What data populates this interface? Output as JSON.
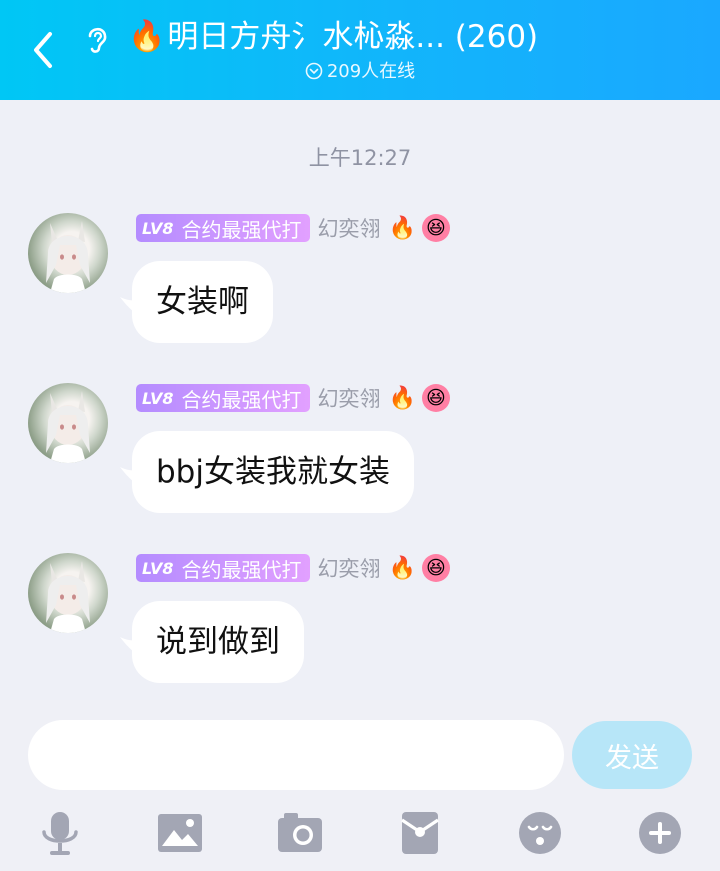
{
  "header": {
    "title": "明日方舟氵水杺淼... (260)",
    "online": "209人在线"
  },
  "time_label": "上午12:27",
  "sender": {
    "level": "LV8",
    "title": "合约最强代打",
    "nickname": "幻奕翎"
  },
  "messages": [
    {
      "text": "女装啊"
    },
    {
      "text": "bbj女装我就女装"
    },
    {
      "text": "说到做到"
    }
  ],
  "input": {
    "placeholder": "",
    "send_label": "发送"
  },
  "toolbar": {
    "icons": [
      "microphone-icon",
      "image-icon",
      "camera-icon",
      "red-packet-icon",
      "emoji-icon",
      "plus-icon"
    ]
  },
  "colors": {
    "header_start": "#00c7f5",
    "header_end": "#1aa8ff",
    "level_badge": "#c193ff",
    "send_button": "#b7e6f8",
    "icon_gray": "#a3a6b4"
  }
}
